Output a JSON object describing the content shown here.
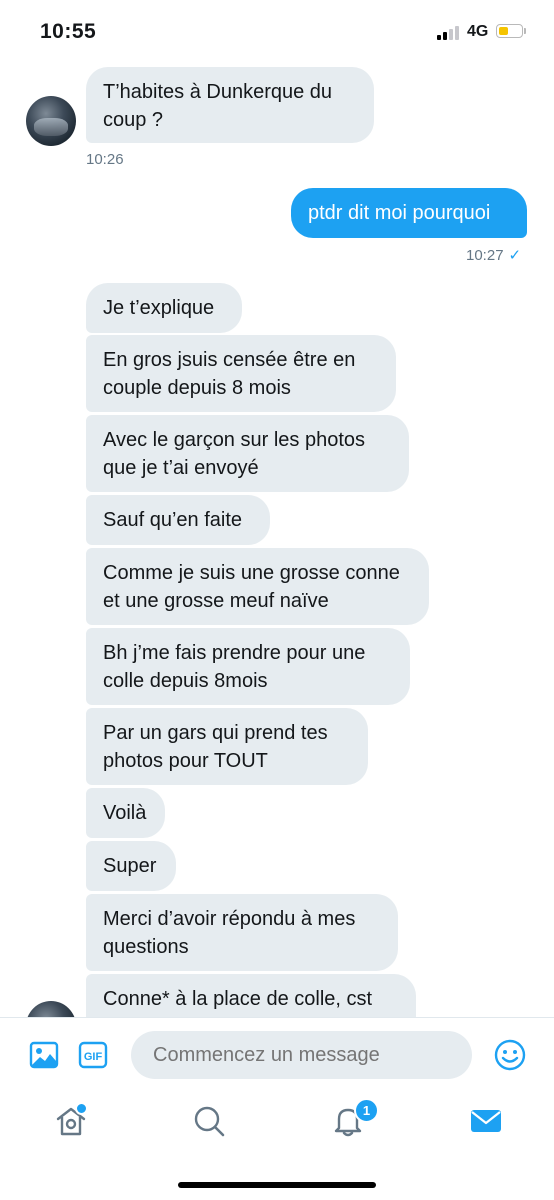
{
  "status_bar": {
    "time": "10:55",
    "network": "4G"
  },
  "conversation": {
    "messages": [
      {
        "from": "them",
        "text": "T’habites à Dunkerque du coup ?",
        "time": "10:26"
      },
      {
        "from": "me",
        "text": "ptdr dit moi pourquoi",
        "time": "10:27"
      },
      {
        "from": "them",
        "text": "Je t’explique"
      },
      {
        "from": "them",
        "text": "En gros jsuis censée être en couple depuis 8 mois"
      },
      {
        "from": "them",
        "text": "Avec le garçon sur les photos que je t’ai envoyé"
      },
      {
        "from": "them",
        "text": "Sauf qu’en faite"
      },
      {
        "from": "them",
        "text": "Comme je suis une grosse conne et une grosse meuf naïve"
      },
      {
        "from": "them",
        "text": "Bh j’me fais prendre pour une colle depuis 8mois"
      },
      {
        "from": "them",
        "text": "Par un gars qui prend tes photos pour TOUT"
      },
      {
        "from": "them",
        "text": "Voilà"
      },
      {
        "from": "them",
        "text": "Super"
      },
      {
        "from": "them",
        "text": "Merci d’avoir répondu à mes questions"
      },
      {
        "from": "them",
        "text": "Conne* à la place de colle, cst"
      }
    ],
    "read_mark": "✓"
  },
  "composer": {
    "placeholder": "Commencez un message",
    "icons": [
      "image-icon",
      "gif-icon",
      "emoji-icon"
    ],
    "gif_label": "GIF"
  },
  "tab_bar": {
    "tabs": [
      "home",
      "search",
      "notifications",
      "messages"
    ],
    "notification_count": "1",
    "home_has_dot": true
  },
  "colors": {
    "accent": "#1da1f2",
    "incoming_bubble": "#e6ecf0",
    "timestamp": "#657786",
    "battery": "#f5c400"
  }
}
